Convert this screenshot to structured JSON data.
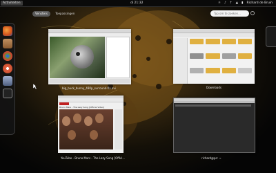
{
  "topbar": {
    "activities_label": "Activiteiten",
    "clock": "di 21:32",
    "user_name": "Richard de Bruin"
  },
  "overview": {
    "tabs": [
      {
        "label": "Vensters",
        "active": true
      },
      {
        "label": "Toepassingen",
        "active": false
      }
    ],
    "search": {
      "placeholder": "Typ om te zoeken..."
    }
  },
  "windows": [
    {
      "title": "big_buck_bunny_480p_surround-fix.avi"
    },
    {
      "title": "Downloads"
    },
    {
      "title": "YouTube - Bruno Mars - The Lazy Song [Offici..."
    },
    {
      "title": "richard@pc: ~"
    }
  ],
  "youtube_video_title": "Bruno Mars - The Lazy Song [Official Video]",
  "dash": {
    "apps": [
      {
        "icon": "firefox-icon",
        "color": "#e06a1a"
      },
      {
        "icon": "files-icon",
        "color": "#b08050"
      },
      {
        "icon": "chrome-icon",
        "color": "#5a8a3a"
      },
      {
        "icon": "ubuntu-one-icon",
        "color": "#d06040"
      },
      {
        "icon": "software-center-icon",
        "color": "#7080a0"
      },
      {
        "icon": "terminal-icon",
        "color": "#303030"
      }
    ]
  }
}
